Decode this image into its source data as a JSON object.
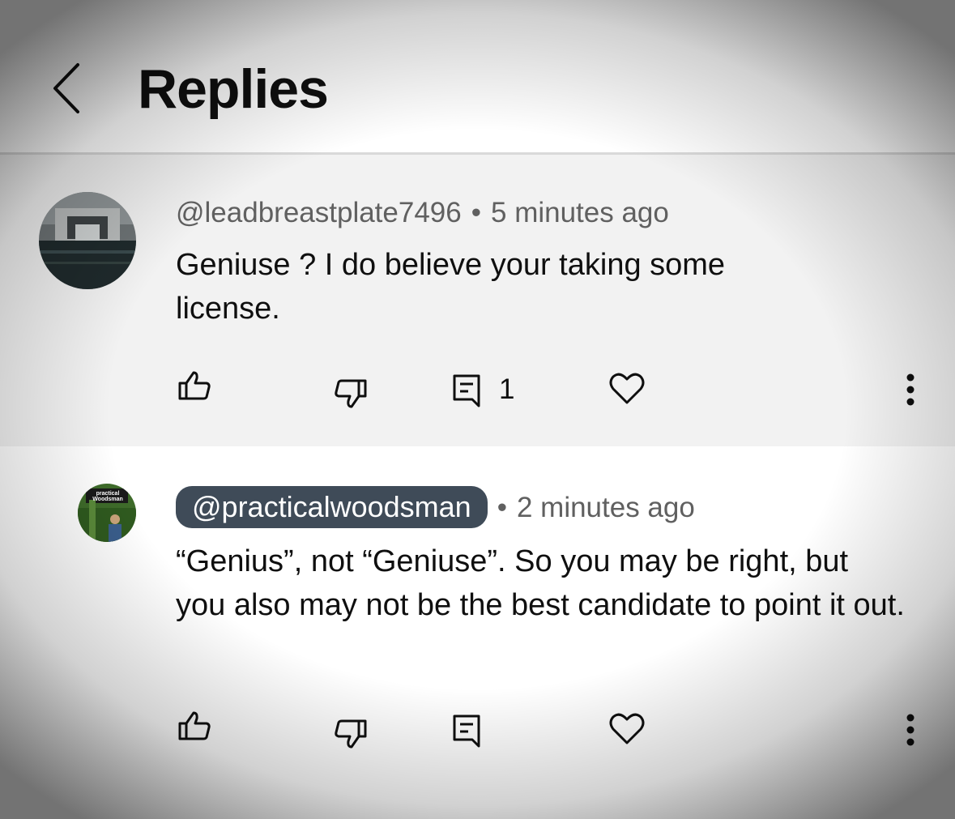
{
  "header": {
    "title": "Replies",
    "back_icon": "chevron-left-icon"
  },
  "comments": [
    {
      "handle": "@leadbreastplate7496",
      "separator": "•",
      "time": "5 minutes ago",
      "text": "Geniuse ? I do believe your taking some license.",
      "reply_count": "1",
      "icons": [
        "thumbs-up-icon",
        "thumbs-down-icon",
        "reply-comment-icon",
        "heart-icon",
        "more-vertical-icon"
      ]
    },
    {
      "handle": "@practicalwoodsman",
      "handle_is_creator": true,
      "separator": "•",
      "time": "2 minutes ago",
      "text": "“Genius”, not “Geniuse”. So you may be right, but you also may not be the best candidate to point it out.",
      "avatar_text": "practical Woodsman",
      "icons": [
        "thumbs-up-icon",
        "thumbs-down-icon",
        "reply-comment-icon",
        "heart-icon",
        "more-vertical-icon"
      ]
    }
  ],
  "colors": {
    "creator_chip_bg": "#3f4b58",
    "parent_bg": "#f2f2f2",
    "meta_text": "#606060"
  }
}
